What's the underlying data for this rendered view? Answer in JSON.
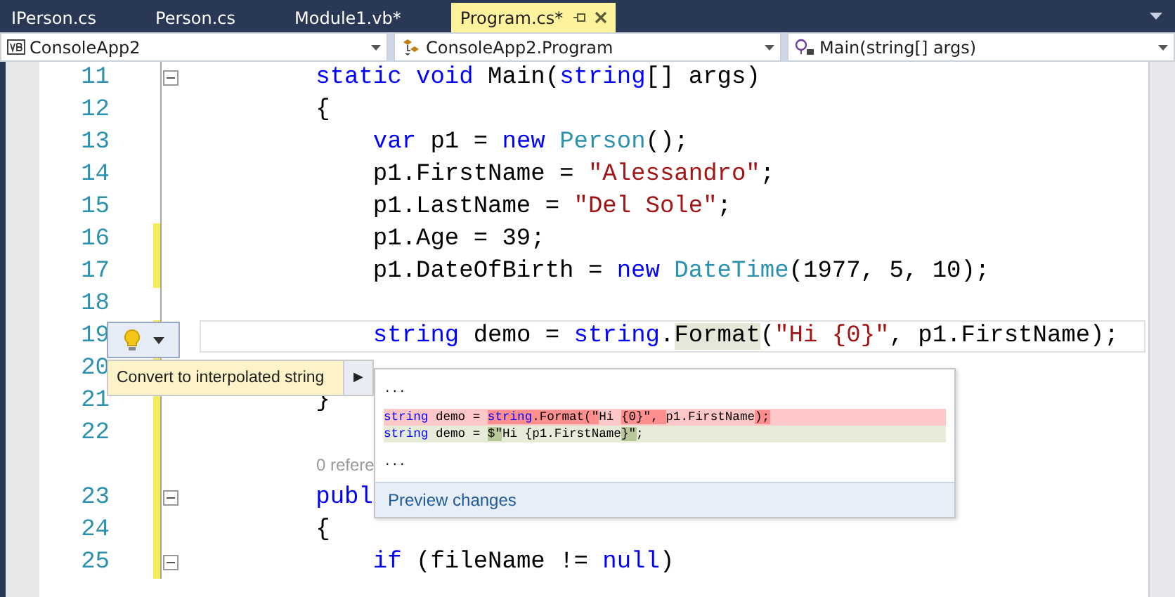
{
  "tabs": [
    {
      "label": "IPerson.cs",
      "selected": false
    },
    {
      "label": "Person.cs",
      "selected": false
    },
    {
      "label": "Module1.vb*",
      "selected": false
    },
    {
      "label": "Program.cs*",
      "selected": true
    }
  ],
  "navigation_bar": [
    {
      "kind": "project",
      "text": "ConsoleApp2"
    },
    {
      "kind": "class",
      "text": "ConsoleApp2.Program"
    },
    {
      "kind": "method",
      "text": "Main(string[] args)"
    }
  ],
  "editor": {
    "lines": [
      {
        "kind": "code",
        "number": "11",
        "changed": false,
        "collapsible": true,
        "current": false,
        "tokens": [
          {
            "kind": "keyword",
            "text": "        static "
          },
          {
            "kind": "keyword",
            "text": "void"
          },
          {
            "kind": "plain",
            "text": " Main("
          },
          {
            "kind": "keyword",
            "text": "string"
          },
          {
            "kind": "plain",
            "text": "[] args)"
          }
        ]
      },
      {
        "kind": "code",
        "number": "12",
        "changed": false,
        "collapsible": false,
        "current": false,
        "tokens": [
          {
            "kind": "plain",
            "text": "        {"
          }
        ]
      },
      {
        "kind": "code",
        "number": "13",
        "changed": false,
        "collapsible": false,
        "current": false,
        "tokens": [
          {
            "kind": "keyword",
            "text": "            var"
          },
          {
            "kind": "plain",
            "text": " p1 = "
          },
          {
            "kind": "keyword",
            "text": "new "
          },
          {
            "kind": "type",
            "text": "Person"
          },
          {
            "kind": "plain",
            "text": "();"
          }
        ]
      },
      {
        "kind": "code",
        "number": "14",
        "changed": false,
        "collapsible": false,
        "current": false,
        "tokens": [
          {
            "kind": "plain",
            "text": "            p1.FirstName = "
          },
          {
            "kind": "string",
            "text": "\"Alessandro\""
          },
          {
            "kind": "plain",
            "text": ";"
          }
        ]
      },
      {
        "kind": "code",
        "number": "15",
        "changed": false,
        "collapsible": false,
        "current": false,
        "tokens": [
          {
            "kind": "plain",
            "text": "            p1.LastName = "
          },
          {
            "kind": "string",
            "text": "\"Del Sole\""
          },
          {
            "kind": "plain",
            "text": ";"
          }
        ]
      },
      {
        "kind": "code",
        "number": "16",
        "changed": true,
        "collapsible": false,
        "current": false,
        "tokens": [
          {
            "kind": "plain",
            "text": "            p1.Age = 39;"
          }
        ]
      },
      {
        "kind": "code",
        "number": "17",
        "changed": true,
        "collapsible": false,
        "current": false,
        "tokens": [
          {
            "kind": "plain",
            "text": "            p1.DateOfBirth = "
          },
          {
            "kind": "keyword",
            "text": "new "
          },
          {
            "kind": "type",
            "text": "DateTime"
          },
          {
            "kind": "plain",
            "text": "(1977, 5, 10);"
          }
        ]
      },
      {
        "kind": "code",
        "number": "18",
        "changed": false,
        "collapsible": false,
        "current": false
      },
      {
        "kind": "code",
        "number": "19",
        "changed": true,
        "collapsible": false,
        "current": true,
        "tokens": [
          {
            "kind": "keyword",
            "text": "            string"
          },
          {
            "kind": "plain",
            "text": " demo = "
          },
          {
            "kind": "keyword",
            "text": "string"
          },
          {
            "kind": "plain",
            "text": "."
          },
          {
            "kind": "reference",
            "text": "Format"
          },
          {
            "kind": "plain",
            "text": "("
          },
          {
            "kind": "string",
            "text": "\"Hi {0}\""
          },
          {
            "kind": "plain",
            "text": ", p1.FirstName);"
          }
        ]
      },
      {
        "kind": "code",
        "number": "20",
        "changed": true,
        "collapsible": false,
        "current": false
      },
      {
        "kind": "code",
        "number": "21",
        "changed": true,
        "collapsible": false,
        "current": false,
        "tokens": [
          {
            "kind": "plain",
            "text": "        }"
          }
        ]
      },
      {
        "kind": "code",
        "number": "22",
        "changed": true,
        "collapsible": false,
        "current": false
      },
      {
        "kind": "codelens",
        "changed": true,
        "text": "0 refere"
      },
      {
        "kind": "code",
        "number": "23",
        "changed": true,
        "collapsible": true,
        "current": false,
        "tokens": [
          {
            "kind": "keyword",
            "text": "        publ"
          }
        ]
      },
      {
        "kind": "code",
        "number": "24",
        "changed": true,
        "collapsible": false,
        "current": false,
        "tokens": [
          {
            "kind": "plain",
            "text": "        {"
          }
        ]
      },
      {
        "kind": "code",
        "number": "25",
        "changed": true,
        "collapsible": true,
        "current": false,
        "tokens": [
          {
            "kind": "keyword",
            "text": "            if"
          },
          {
            "kind": "plain",
            "text": " (fileName != "
          },
          {
            "kind": "keyword",
            "text": "null"
          },
          {
            "kind": "plain",
            "text": ")"
          }
        ]
      }
    ]
  },
  "quick_actions": {
    "menu_item": "Convert to interpolated string",
    "submenu_arrow": "▶"
  },
  "preview": {
    "lines": [
      {
        "kind": "ellipsis",
        "text": "..."
      },
      {
        "kind": "blank"
      },
      {
        "kind": "removed",
        "tokens": [
          {
            "kind": "keyword",
            "changed": false,
            "text": "string"
          },
          {
            "kind": "plain",
            "changed": false,
            "text": " demo = "
          },
          {
            "kind": "keyword",
            "changed": true,
            "text": "string"
          },
          {
            "kind": "plain",
            "changed": true,
            "text": ".Format(\""
          },
          {
            "kind": "plain",
            "changed": false,
            "text": "Hi "
          },
          {
            "kind": "plain",
            "changed": true,
            "text": "{0}\", "
          },
          {
            "kind": "plain",
            "changed": false,
            "text": "p1.FirstName"
          },
          {
            "kind": "plain",
            "changed": true,
            "text": ");"
          }
        ]
      },
      {
        "kind": "added",
        "tokens": [
          {
            "kind": "keyword",
            "changed": false,
            "text": "string"
          },
          {
            "kind": "plain",
            "changed": false,
            "text": " demo = "
          },
          {
            "kind": "plain",
            "changed": true,
            "text": "$\""
          },
          {
            "kind": "plain",
            "changed": false,
            "text": "Hi {p1.FirstName"
          },
          {
            "kind": "plain",
            "changed": true,
            "text": "}\""
          },
          {
            "kind": "plain",
            "changed": false,
            "text": ";"
          }
        ]
      },
      {
        "kind": "blank"
      },
      {
        "kind": "ellipsis",
        "text": "..."
      }
    ],
    "link": "Preview changes"
  }
}
